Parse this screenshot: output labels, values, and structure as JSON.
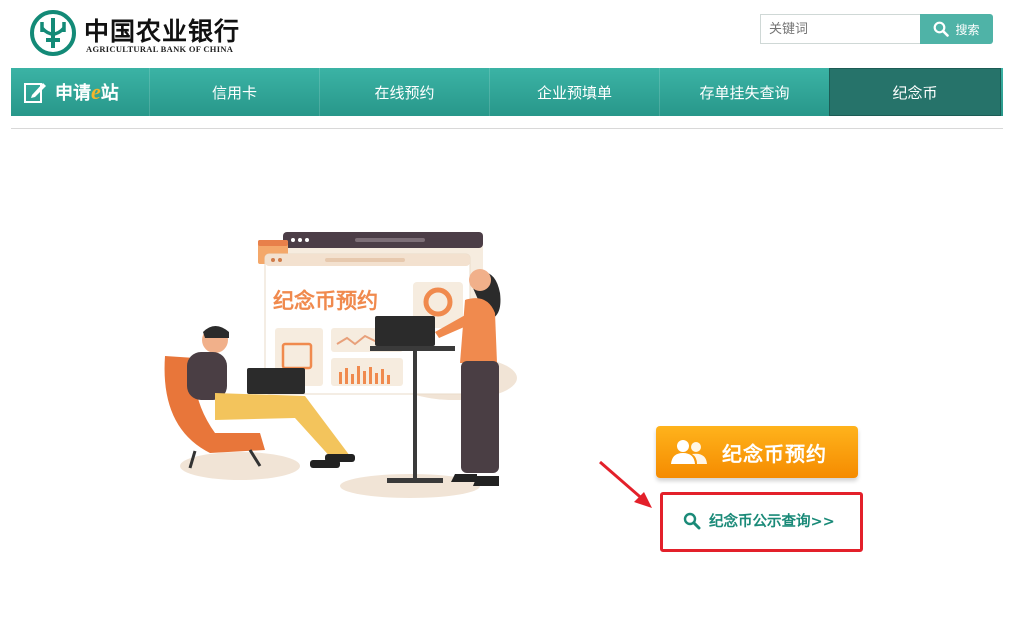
{
  "header": {
    "logo_cn": "中国农业银行",
    "logo_en": "AGRICULTURAL BANK OF CHINA",
    "search_placeholder": "关键词",
    "search_button": "搜索"
  },
  "nav": {
    "brand_prefix": "申请",
    "brand_e": "e",
    "brand_suffix": "站",
    "items": [
      {
        "label": "信用卡"
      },
      {
        "label": "在线预约"
      },
      {
        "label": "企业预填单"
      },
      {
        "label": "存单挂失查询"
      },
      {
        "label": "纪念币",
        "active": true
      }
    ]
  },
  "illustration": {
    "screen_title": "纪念币预约"
  },
  "actions": {
    "reserve_button": "纪念币预约",
    "query_link": "纪念币公示查询>>"
  },
  "colors": {
    "brand_green": "#2a9d8f",
    "nav_active": "#26736a",
    "accent_orange": "#f59a0a",
    "highlight_red": "#e3202a"
  }
}
